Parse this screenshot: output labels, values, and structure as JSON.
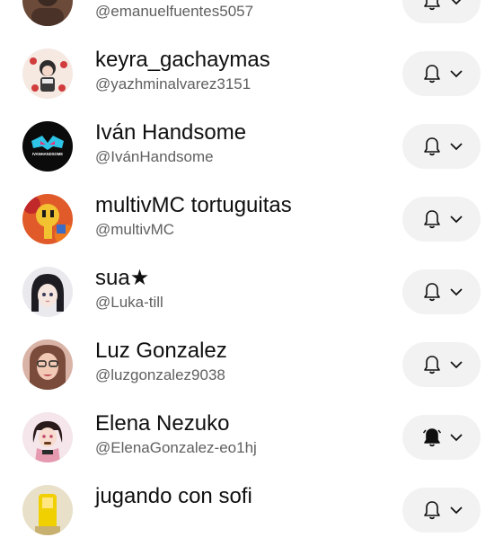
{
  "subscriptions": [
    {
      "name": "",
      "handle": "@emanuelfuentes5057",
      "notification": "bell-outline-icon",
      "avatar_colors": [
        "#6b4a3a",
        "#3b2a22"
      ]
    },
    {
      "name": "keyra_gachaymas",
      "handle": "@yazhminalvarez3151",
      "notification": "bell-outline-icon",
      "avatar_colors": [
        "#f5e9e2",
        "#d13c3c"
      ]
    },
    {
      "name": "Iván Handsome",
      "handle": "@IvánHandsome",
      "notification": "bell-outline-icon",
      "avatar_colors": [
        "#0b0b0b",
        "#2ec5e8"
      ],
      "avatar_text": "IVANHANDSOME"
    },
    {
      "name": "multivMC tortuguitas",
      "handle": "@multivMC",
      "notification": "bell-outline-icon",
      "avatar_colors": [
        "#e05a2a",
        "#f2c230"
      ]
    },
    {
      "name": "sua★",
      "handle": "@Luka-till",
      "notification": "bell-outline-icon",
      "avatar_colors": [
        "#e9e9ee",
        "#1c1c22"
      ]
    },
    {
      "name": "Luz Gonzalez",
      "handle": "@luzgonzalez9038",
      "notification": "bell-outline-icon",
      "avatar_colors": [
        "#d9b3a6",
        "#7a4a3a"
      ]
    },
    {
      "name": "Elena Nezuko",
      "handle": "@ElenaGonzalez-eo1hj",
      "notification": "bell-filled-icon",
      "avatar_colors": [
        "#f4e6ea",
        "#c2486a"
      ]
    },
    {
      "name": "jugando con sofi",
      "handle": "",
      "notification": "bell-outline-icon",
      "avatar_colors": [
        "#e8e0c8",
        "#f0d000"
      ]
    }
  ],
  "colors": {
    "name_text": "#0f0f0f",
    "handle_text": "#606060",
    "button_bg": "#f2f2f2"
  }
}
